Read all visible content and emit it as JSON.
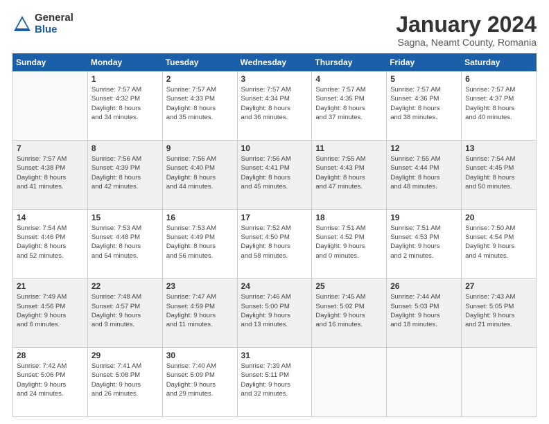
{
  "header": {
    "logo_general": "General",
    "logo_blue": "Blue",
    "month_title": "January 2024",
    "subtitle": "Sagna, Neamt County, Romania"
  },
  "days_of_week": [
    "Sunday",
    "Monday",
    "Tuesday",
    "Wednesday",
    "Thursday",
    "Friday",
    "Saturday"
  ],
  "weeks": [
    [
      {
        "num": "",
        "info": ""
      },
      {
        "num": "1",
        "info": "Sunrise: 7:57 AM\nSunset: 4:32 PM\nDaylight: 8 hours\nand 34 minutes."
      },
      {
        "num": "2",
        "info": "Sunrise: 7:57 AM\nSunset: 4:33 PM\nDaylight: 8 hours\nand 35 minutes."
      },
      {
        "num": "3",
        "info": "Sunrise: 7:57 AM\nSunset: 4:34 PM\nDaylight: 8 hours\nand 36 minutes."
      },
      {
        "num": "4",
        "info": "Sunrise: 7:57 AM\nSunset: 4:35 PM\nDaylight: 8 hours\nand 37 minutes."
      },
      {
        "num": "5",
        "info": "Sunrise: 7:57 AM\nSunset: 4:36 PM\nDaylight: 8 hours\nand 38 minutes."
      },
      {
        "num": "6",
        "info": "Sunrise: 7:57 AM\nSunset: 4:37 PM\nDaylight: 8 hours\nand 40 minutes."
      }
    ],
    [
      {
        "num": "7",
        "info": "Sunrise: 7:57 AM\nSunset: 4:38 PM\nDaylight: 8 hours\nand 41 minutes."
      },
      {
        "num": "8",
        "info": "Sunrise: 7:56 AM\nSunset: 4:39 PM\nDaylight: 8 hours\nand 42 minutes."
      },
      {
        "num": "9",
        "info": "Sunrise: 7:56 AM\nSunset: 4:40 PM\nDaylight: 8 hours\nand 44 minutes."
      },
      {
        "num": "10",
        "info": "Sunrise: 7:56 AM\nSunset: 4:41 PM\nDaylight: 8 hours\nand 45 minutes."
      },
      {
        "num": "11",
        "info": "Sunrise: 7:55 AM\nSunset: 4:43 PM\nDaylight: 8 hours\nand 47 minutes."
      },
      {
        "num": "12",
        "info": "Sunrise: 7:55 AM\nSunset: 4:44 PM\nDaylight: 8 hours\nand 48 minutes."
      },
      {
        "num": "13",
        "info": "Sunrise: 7:54 AM\nSunset: 4:45 PM\nDaylight: 8 hours\nand 50 minutes."
      }
    ],
    [
      {
        "num": "14",
        "info": "Sunrise: 7:54 AM\nSunset: 4:46 PM\nDaylight: 8 hours\nand 52 minutes."
      },
      {
        "num": "15",
        "info": "Sunrise: 7:53 AM\nSunset: 4:48 PM\nDaylight: 8 hours\nand 54 minutes."
      },
      {
        "num": "16",
        "info": "Sunrise: 7:53 AM\nSunset: 4:49 PM\nDaylight: 8 hours\nand 56 minutes."
      },
      {
        "num": "17",
        "info": "Sunrise: 7:52 AM\nSunset: 4:50 PM\nDaylight: 8 hours\nand 58 minutes."
      },
      {
        "num": "18",
        "info": "Sunrise: 7:51 AM\nSunset: 4:52 PM\nDaylight: 9 hours\nand 0 minutes."
      },
      {
        "num": "19",
        "info": "Sunrise: 7:51 AM\nSunset: 4:53 PM\nDaylight: 9 hours\nand 2 minutes."
      },
      {
        "num": "20",
        "info": "Sunrise: 7:50 AM\nSunset: 4:54 PM\nDaylight: 9 hours\nand 4 minutes."
      }
    ],
    [
      {
        "num": "21",
        "info": "Sunrise: 7:49 AM\nSunset: 4:56 PM\nDaylight: 9 hours\nand 6 minutes."
      },
      {
        "num": "22",
        "info": "Sunrise: 7:48 AM\nSunset: 4:57 PM\nDaylight: 9 hours\nand 9 minutes."
      },
      {
        "num": "23",
        "info": "Sunrise: 7:47 AM\nSunset: 4:59 PM\nDaylight: 9 hours\nand 11 minutes."
      },
      {
        "num": "24",
        "info": "Sunrise: 7:46 AM\nSunset: 5:00 PM\nDaylight: 9 hours\nand 13 minutes."
      },
      {
        "num": "25",
        "info": "Sunrise: 7:45 AM\nSunset: 5:02 PM\nDaylight: 9 hours\nand 16 minutes."
      },
      {
        "num": "26",
        "info": "Sunrise: 7:44 AM\nSunset: 5:03 PM\nDaylight: 9 hours\nand 18 minutes."
      },
      {
        "num": "27",
        "info": "Sunrise: 7:43 AM\nSunset: 5:05 PM\nDaylight: 9 hours\nand 21 minutes."
      }
    ],
    [
      {
        "num": "28",
        "info": "Sunrise: 7:42 AM\nSunset: 5:06 PM\nDaylight: 9 hours\nand 24 minutes."
      },
      {
        "num": "29",
        "info": "Sunrise: 7:41 AM\nSunset: 5:08 PM\nDaylight: 9 hours\nand 26 minutes."
      },
      {
        "num": "30",
        "info": "Sunrise: 7:40 AM\nSunset: 5:09 PM\nDaylight: 9 hours\nand 29 minutes."
      },
      {
        "num": "31",
        "info": "Sunrise: 7:39 AM\nSunset: 5:11 PM\nDaylight: 9 hours\nand 32 minutes."
      },
      {
        "num": "",
        "info": ""
      },
      {
        "num": "",
        "info": ""
      },
      {
        "num": "",
        "info": ""
      }
    ]
  ]
}
